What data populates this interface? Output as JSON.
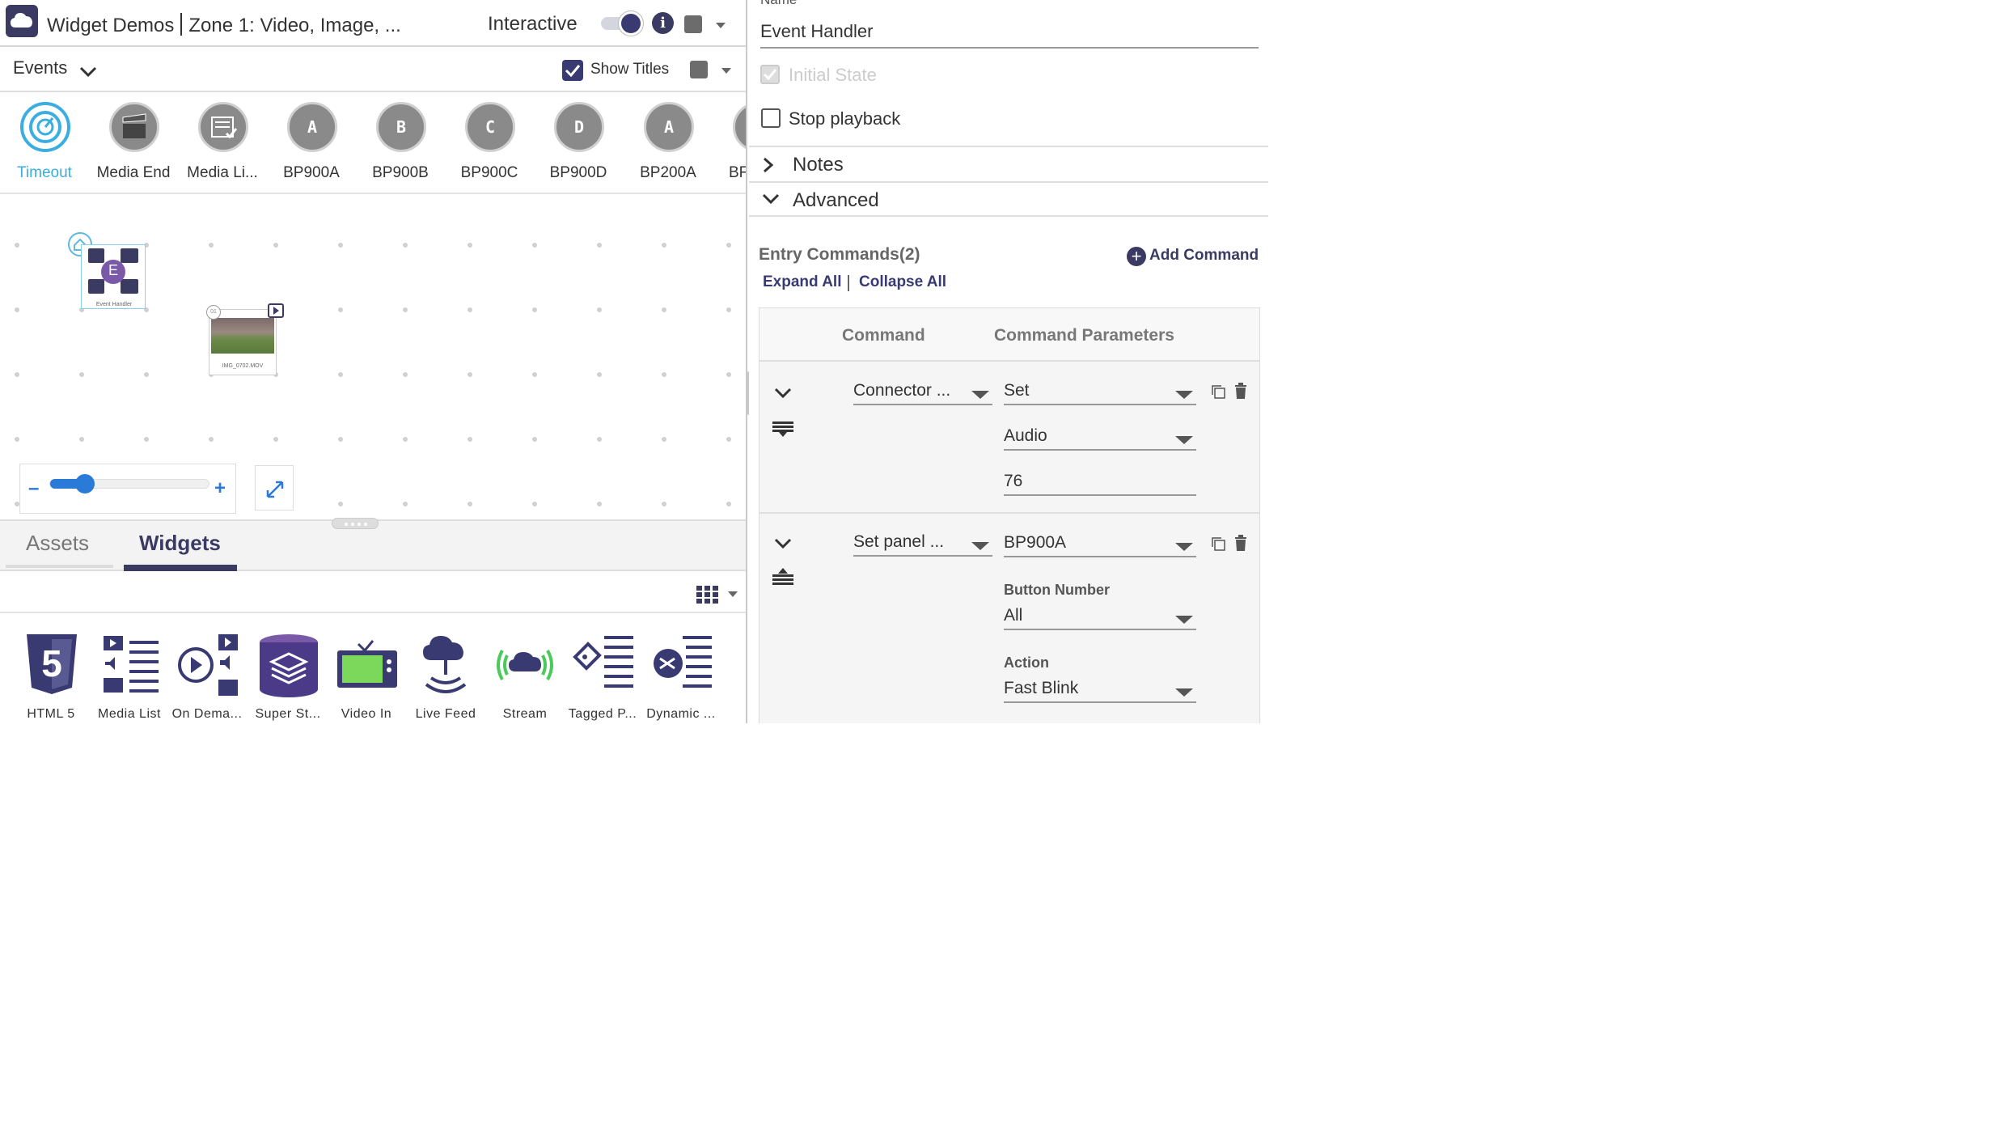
{
  "app": {
    "title_part1": "Widget Demos",
    "title_part2": "Zone 1: Video, Image, ...",
    "interactive_label": "Interactive",
    "interactive_on": true
  },
  "events_bar": {
    "label": "Events",
    "show_titles_label": "Show Titles",
    "show_titles_checked": true
  },
  "palette": [
    {
      "label": "Timeout",
      "icon": "timer-icon",
      "glyph": "",
      "active": true
    },
    {
      "label": "Media End",
      "icon": "clapperboard-icon",
      "glyph": "",
      "active": false
    },
    {
      "label": "Media Li...",
      "icon": "media-list-icon",
      "glyph": "",
      "active": false
    },
    {
      "label": "BP900A",
      "icon": "button-panel-icon",
      "glyph": "A",
      "active": false
    },
    {
      "label": "BP900B",
      "icon": "button-panel-icon",
      "glyph": "B",
      "active": false
    },
    {
      "label": "BP900C",
      "icon": "button-panel-icon",
      "glyph": "C",
      "active": false
    },
    {
      "label": "BP900D",
      "icon": "button-panel-icon",
      "glyph": "D",
      "active": false
    },
    {
      "label": "BP200A",
      "icon": "button-panel-icon",
      "glyph": "A",
      "active": false
    },
    {
      "label": "BF",
      "icon": "button-panel-icon",
      "glyph": "",
      "active": false
    }
  ],
  "canvas": {
    "event_handler_node_label": "Event Handler",
    "event_handler_badge": "E",
    "video_node_label": "IMG_0702.MOV",
    "video_node_number": "01",
    "zoom_level": 0.22
  },
  "bottom_tabs": {
    "assets": "Assets",
    "widgets": "Widgets",
    "active": "widgets"
  },
  "widgets": [
    {
      "label": "HTML 5",
      "icon": "html5-icon"
    },
    {
      "label": "Media List",
      "icon": "media-list-icon"
    },
    {
      "label": "On Dema...",
      "icon": "on-demand-icon"
    },
    {
      "label": "Super St...",
      "icon": "super-state-icon"
    },
    {
      "label": "Video In",
      "icon": "tv-icon"
    },
    {
      "label": "Live Feed",
      "icon": "live-feed-icon"
    },
    {
      "label": "Stream",
      "icon": "stream-icon"
    },
    {
      "label": "Tagged P...",
      "icon": "tagged-playlist-icon"
    },
    {
      "label": "Dynamic ...",
      "icon": "dynamic-playlist-icon"
    }
  ],
  "properties": {
    "name_label": "Name",
    "name_value": "Event Handler",
    "initial_state_label": "Initial State",
    "initial_state_checked": true,
    "initial_state_disabled": true,
    "stop_playback_label": "Stop playback",
    "stop_playback_checked": false,
    "notes_label": "Notes",
    "advanced_label": "Advanced"
  },
  "entry_commands": {
    "title": "Entry Commands(2)",
    "add_command": "Add Command",
    "expand_all": "Expand All",
    "collapse_all": "Collapse All",
    "col_command": "Command",
    "col_params": "Command Parameters",
    "rows": [
      {
        "command": "Connector ...",
        "param1": "Set",
        "param2": "Audio",
        "param3": "76"
      },
      {
        "command": "Set panel ...",
        "param1": "BP900A",
        "button_number_label": "Button Number",
        "button_number": "All",
        "action_label": "Action",
        "action": "Fast Blink"
      }
    ]
  },
  "colors": {
    "accent": "#3a3a63",
    "active_blue": "#3aaee0",
    "zoom_blue": "#2a7ad8"
  }
}
